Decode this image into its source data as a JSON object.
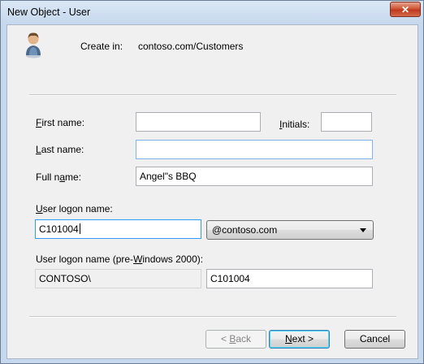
{
  "window": {
    "title": "New Object - User",
    "close_glyph": "✕"
  },
  "header": {
    "icon": "user-icon",
    "create_in_label": "Create in:",
    "create_in_path": "contoso.com/Customers"
  },
  "form": {
    "first_name": {
      "label_key": "F",
      "label_rest": "irst name:",
      "value": ""
    },
    "initials": {
      "label_key": "I",
      "label_rest": "nitials:",
      "value": ""
    },
    "last_name": {
      "label_key": "L",
      "label_rest": "ast name:",
      "value": ""
    },
    "full_name": {
      "label_pre": "Full n",
      "label_key": "a",
      "label_rest": "me:",
      "value": "Angel\"s BBQ"
    },
    "logon_name": {
      "label_key": "U",
      "label_rest": "ser logon name:",
      "value": "C101004"
    },
    "upn_suffix": {
      "selected": "@contoso.com"
    },
    "pre2000": {
      "label_pre": "User logon name (pre-",
      "label_key": "W",
      "label_rest": "indows 2000):",
      "domain": "CONTOSO\\",
      "value": "C101004"
    }
  },
  "buttons": {
    "back_pre": "< ",
    "back_key": "B",
    "back_rest": "ack",
    "next_key": "N",
    "next_rest": "ext >",
    "cancel": "Cancel"
  },
  "colors": {
    "client_bg": "#f0f0f0",
    "frame": "#c5d8ee",
    "close_red": "#c0391e",
    "focus_border": "#3399ff"
  }
}
